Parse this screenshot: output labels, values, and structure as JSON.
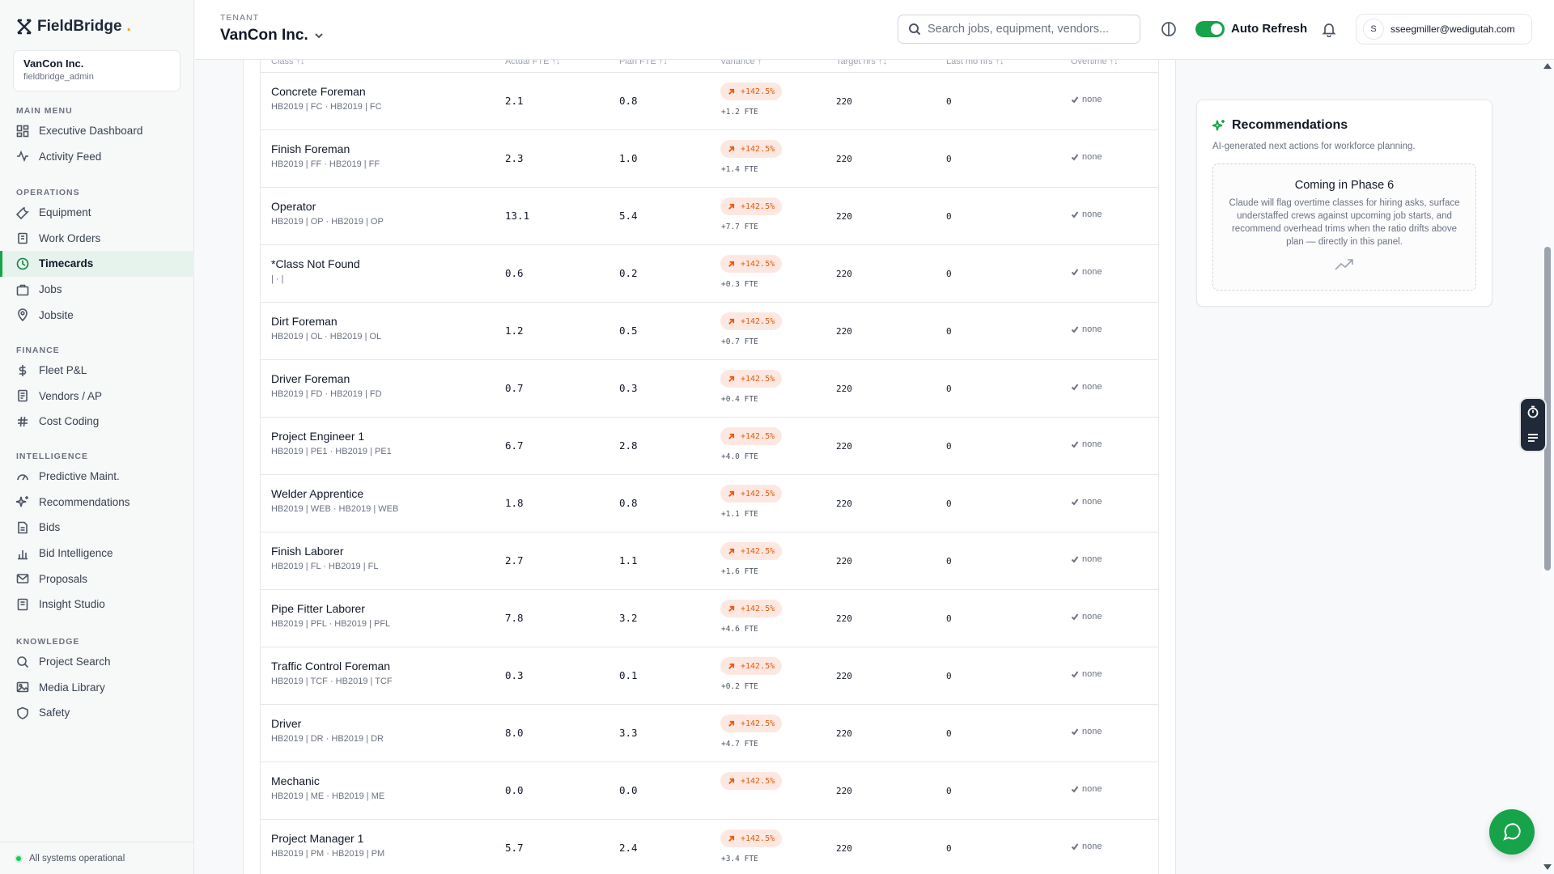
{
  "brand": {
    "name": "FieldBridge",
    "dot": "."
  },
  "tenant_card": {
    "name": "VanCon Inc.",
    "user": "fieldbridge_admin"
  },
  "sidebar": {
    "sections": [
      {
        "heading": "MAIN MENU",
        "items": [
          {
            "label": "Executive Dashboard",
            "icon": "dashboard-icon"
          },
          {
            "label": "Activity Feed",
            "icon": "activity-icon"
          }
        ]
      },
      {
        "heading": "OPERATIONS",
        "items": [
          {
            "label": "Equipment",
            "icon": "wrench-icon"
          },
          {
            "label": "Work Orders",
            "icon": "clipboard-icon"
          },
          {
            "label": "Timecards",
            "icon": "clock-icon",
            "active": true
          },
          {
            "label": "Jobs",
            "icon": "briefcase-icon"
          },
          {
            "label": "Jobsite",
            "icon": "map-pin-icon"
          }
        ]
      },
      {
        "heading": "FINANCE",
        "items": [
          {
            "label": "Fleet P&L",
            "icon": "dollar-icon"
          },
          {
            "label": "Vendors / AP",
            "icon": "receipt-icon"
          },
          {
            "label": "Cost Coding",
            "icon": "hash-icon"
          }
        ]
      },
      {
        "heading": "INTELLIGENCE",
        "items": [
          {
            "label": "Predictive Maint.",
            "icon": "gauge-icon"
          },
          {
            "label": "Recommendations",
            "icon": "sparkles-icon"
          },
          {
            "label": "Bids",
            "icon": "document-icon"
          },
          {
            "label": "Bid Intelligence",
            "icon": "bar-chart-icon"
          },
          {
            "label": "Proposals",
            "icon": "mail-icon"
          },
          {
            "label": "Insight Studio",
            "icon": "notebook-icon"
          }
        ]
      },
      {
        "heading": "KNOWLEDGE",
        "items": [
          {
            "label": "Project Search",
            "icon": "search-icon"
          },
          {
            "label": "Media Library",
            "icon": "image-icon"
          },
          {
            "label": "Safety",
            "icon": "shield-icon"
          }
        ]
      }
    ],
    "status": "All systems operational"
  },
  "header": {
    "tenant_label": "TENANT",
    "tenant_name": "VanCon Inc.",
    "search_placeholder": "Search jobs, equipment, vendors...",
    "auto_refresh_label": "Auto Refresh",
    "auto_refresh_on": true,
    "user_initial": "S",
    "user_email": "sseegmiller@wedigutah.com"
  },
  "table": {
    "columns": [
      "Class ↑↓",
      "Actual FTE ↑↓",
      "Plan FTE ↑↓",
      "Variance ↑",
      "Target hrs ↑↓",
      "Last mo hrs ↑↓",
      "Overtime ↑↓"
    ],
    "rows": [
      {
        "name": "Concrete Foreman",
        "codes": "HB2019 | FC · HB2019 | FC",
        "actual": "2.1",
        "plan": "0.8",
        "variance": "+142.5%",
        "fte": "+1.2 FTE",
        "target": "220",
        "last": "0",
        "overtime": "none"
      },
      {
        "name": "Finish Foreman",
        "codes": "HB2019 | FF · HB2019 | FF",
        "actual": "2.3",
        "plan": "1.0",
        "variance": "+142.5%",
        "fte": "+1.4 FTE",
        "target": "220",
        "last": "0",
        "overtime": "none"
      },
      {
        "name": "Operator",
        "codes": "HB2019 | OP · HB2019 | OP",
        "actual": "13.1",
        "plan": "5.4",
        "variance": "+142.5%",
        "fte": "+7.7 FTE",
        "target": "220",
        "last": "0",
        "overtime": "none"
      },
      {
        "name": "*Class Not Found",
        "codes": "| · |",
        "actual": "0.6",
        "plan": "0.2",
        "variance": "+142.5%",
        "fte": "+0.3 FTE",
        "target": "220",
        "last": "0",
        "overtime": "none"
      },
      {
        "name": "Dirt Foreman",
        "codes": "HB2019 | OL · HB2019 | OL",
        "actual": "1.2",
        "plan": "0.5",
        "variance": "+142.5%",
        "fte": "+0.7 FTE",
        "target": "220",
        "last": "0",
        "overtime": "none"
      },
      {
        "name": "Driver Foreman",
        "codes": "HB2019 | FD · HB2019 | FD",
        "actual": "0.7",
        "plan": "0.3",
        "variance": "+142.5%",
        "fte": "+0.4 FTE",
        "target": "220",
        "last": "0",
        "overtime": "none"
      },
      {
        "name": "Project Engineer 1",
        "codes": "HB2019 | PE1 · HB2019 | PE1",
        "actual": "6.7",
        "plan": "2.8",
        "variance": "+142.5%",
        "fte": "+4.0 FTE",
        "target": "220",
        "last": "0",
        "overtime": "none"
      },
      {
        "name": "Welder Apprentice",
        "codes": "HB2019 | WEB · HB2019 | WEB",
        "actual": "1.8",
        "plan": "0.8",
        "variance": "+142.5%",
        "fte": "+1.1 FTE",
        "target": "220",
        "last": "0",
        "overtime": "none"
      },
      {
        "name": "Finish Laborer",
        "codes": "HB2019 | FL · HB2019 | FL",
        "actual": "2.7",
        "plan": "1.1",
        "variance": "+142.5%",
        "fte": "+1.6 FTE",
        "target": "220",
        "last": "0",
        "overtime": "none"
      },
      {
        "name": "Pipe Fitter Laborer",
        "codes": "HB2019 | PFL · HB2019 | PFL",
        "actual": "7.8",
        "plan": "3.2",
        "variance": "+142.5%",
        "fte": "+4.6 FTE",
        "target": "220",
        "last": "0",
        "overtime": "none"
      },
      {
        "name": "Traffic Control Foreman",
        "codes": "HB2019 | TCF · HB2019 | TCF",
        "actual": "0.3",
        "plan": "0.1",
        "variance": "+142.5%",
        "fte": "+0.2 FTE",
        "target": "220",
        "last": "0",
        "overtime": "none"
      },
      {
        "name": "Driver",
        "codes": "HB2019 | DR · HB2019 | DR",
        "actual": "8.0",
        "plan": "3.3",
        "variance": "+142.5%",
        "fte": "+4.7 FTE",
        "target": "220",
        "last": "0",
        "overtime": "none"
      },
      {
        "name": "Mechanic",
        "codes": "HB2019 | ME · HB2019 | ME",
        "actual": "0.0",
        "plan": "0.0",
        "variance": "+142.5%",
        "fte": "",
        "target": "220",
        "last": "0",
        "overtime": "none"
      },
      {
        "name": "Project Manager 1",
        "codes": "HB2019 | PM · HB2019 | PM",
        "actual": "5.7",
        "plan": "2.4",
        "variance": "+142.5%",
        "fte": "+3.4 FTE",
        "target": "220",
        "last": "0",
        "overtime": "none"
      }
    ]
  },
  "recommendations": {
    "title": "Recommendations",
    "subtitle": "AI-generated next actions for workforce planning.",
    "coming_title": "Coming in Phase 6",
    "coming_text": "Claude will flag overtime classes for hiring asks, surface understaffed crews against upcoming job starts, and recommend overhead trims when the ratio drifts above plan — directly in this panel."
  },
  "colors": {
    "accent": "#16a34a",
    "variance_bg": "#fde8e1",
    "variance_text": "#ea580c"
  }
}
